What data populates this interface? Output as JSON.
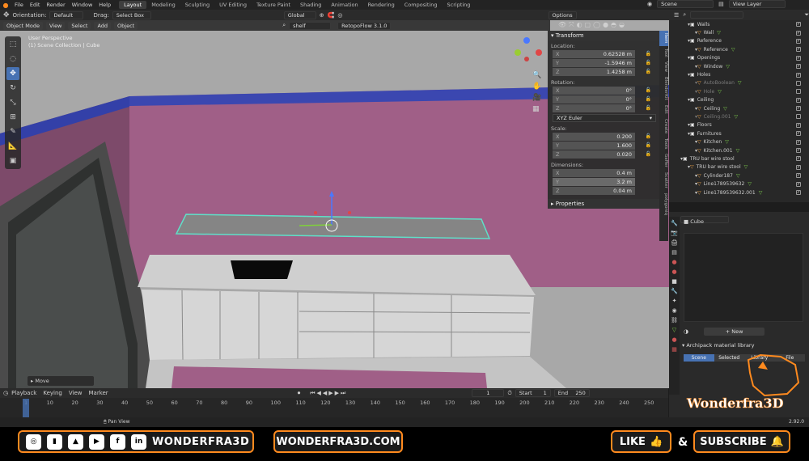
{
  "topmenu": [
    "File",
    "Edit",
    "Render",
    "Window",
    "Help"
  ],
  "workspaces": [
    "Layout",
    "Modeling",
    "Sculpting",
    "UV Editing",
    "Texture Paint",
    "Shading",
    "Animation",
    "Rendering",
    "Compositing",
    "Scripting"
  ],
  "scene_name": "Scene",
  "view_layer": "View Layer",
  "tool_header": {
    "orientation_label": "Orientation:",
    "orientation_value": "Default",
    "drag_label": "Drag:",
    "drag_value": "Select Box",
    "transform_orientation": "Global",
    "options": "Options"
  },
  "viewport_header": {
    "mode": "Object Mode",
    "menus": [
      "View",
      "Select",
      "Add",
      "Object"
    ],
    "search": "shelf",
    "addon": "RetopoFlow 3.1.0"
  },
  "viewport_info": {
    "line1": "User Perspective",
    "line2": "(1) Scene Collection | Cube"
  },
  "last_op": "Move",
  "npanel": {
    "title": "Transform",
    "location_label": "Location:",
    "location": [
      {
        "axis": "X",
        "value": "0.62528 m"
      },
      {
        "axis": "Y",
        "value": "-1.5946 m"
      },
      {
        "axis": "Z",
        "value": "1.4258 m"
      }
    ],
    "rotation_label": "Rotation:",
    "rotation": [
      {
        "axis": "X",
        "value": "0°"
      },
      {
        "axis": "Y",
        "value": "0°"
      },
      {
        "axis": "Z",
        "value": "0°"
      }
    ],
    "rotation_mode": "XYZ Euler",
    "scale_label": "Scale:",
    "scale": [
      {
        "axis": "X",
        "value": "0.200"
      },
      {
        "axis": "Y",
        "value": "1.600"
      },
      {
        "axis": "Z",
        "value": "0.020"
      }
    ],
    "dimensions_label": "Dimensions:",
    "dimensions": [
      {
        "axis": "X",
        "value": "0.4 m"
      },
      {
        "axis": "Y",
        "value": "3.2 m"
      },
      {
        "axis": "Z",
        "value": "0.04 m"
      }
    ],
    "properties_label": "Properties"
  },
  "side_tabs": [
    "Item",
    "Tool",
    "View",
    "BlenderKit",
    "Edit",
    "Create",
    "Tools",
    "Gaffer",
    "Scatter",
    "polygoniq"
  ],
  "outliner": [
    {
      "indent": 1,
      "name": "Walls",
      "type": "collection",
      "checked": true
    },
    {
      "indent": 2,
      "name": "Wall",
      "type": "object",
      "checked": true
    },
    {
      "indent": 1,
      "name": "Reference",
      "type": "collection",
      "checked": true
    },
    {
      "indent": 2,
      "name": "Reference",
      "type": "object",
      "checked": true
    },
    {
      "indent": 1,
      "name": "Openings",
      "type": "collection",
      "checked": true
    },
    {
      "indent": 2,
      "name": "Window",
      "type": "object",
      "checked": true
    },
    {
      "indent": 1,
      "name": "Holes",
      "type": "collection",
      "checked": true
    },
    {
      "indent": 2,
      "name": "AutoBoolean",
      "type": "object",
      "checked": false,
      "dim": true
    },
    {
      "indent": 2,
      "name": "Hole",
      "type": "object",
      "checked": false,
      "dim": true
    },
    {
      "indent": 1,
      "name": "Ceiling",
      "type": "collection",
      "checked": true
    },
    {
      "indent": 2,
      "name": "Ceiling",
      "type": "object",
      "checked": true
    },
    {
      "indent": 2,
      "name": "Ceiling.001",
      "type": "object",
      "checked": false,
      "dim": true
    },
    {
      "indent": 1,
      "name": "Floors",
      "type": "collection",
      "checked": true
    },
    {
      "indent": 1,
      "name": "Furnitures",
      "type": "collection",
      "checked": true
    },
    {
      "indent": 2,
      "name": "Kitchen",
      "type": "object",
      "checked": true
    },
    {
      "indent": 2,
      "name": "Kitchen.001",
      "type": "object",
      "checked": true
    },
    {
      "indent": 0,
      "name": "TRU bar wire stool",
      "type": "collection",
      "checked": true
    },
    {
      "indent": 1,
      "name": "TRU bar wire stool",
      "type": "object",
      "checked": true
    },
    {
      "indent": 2,
      "name": "Cylinder187",
      "type": "object",
      "checked": true
    },
    {
      "indent": 2,
      "name": "Line1789539632",
      "type": "object",
      "checked": true
    },
    {
      "indent": 2,
      "name": "Line1789539632.001",
      "type": "object",
      "checked": true
    }
  ],
  "properties_panel": {
    "object": "Cube",
    "new_button": "New",
    "library_title": "Archipack material library",
    "lib_tabs": [
      "Scene",
      "Selected",
      "Library",
      "File"
    ]
  },
  "timeline": {
    "menus": [
      "Playback",
      "Keying",
      "View",
      "Marker"
    ],
    "current": "1",
    "start_label": "Start",
    "start": "1",
    "end_label": "End",
    "end": "250",
    "ticks": [
      "1",
      "10",
      "20",
      "30",
      "40",
      "50",
      "60",
      "70",
      "80",
      "90",
      "100",
      "110",
      "120",
      "130",
      "140",
      "150",
      "160",
      "170",
      "180",
      "190",
      "200",
      "210",
      "220",
      "230",
      "240",
      "250"
    ]
  },
  "status": {
    "left": "Pan View",
    "version": "2.92.0"
  },
  "footer": {
    "socials": [
      "instagram",
      "twitch",
      "artstation",
      "youtube",
      "facebook",
      "linkedin"
    ],
    "brand": "WONDERFRA3D",
    "website": "WONDERFRA3D.COM",
    "like": "LIKE",
    "amp": "&",
    "subscribe": "SUBSCRIBE",
    "logo_text": "Wonderfra3D"
  },
  "colors": {
    "accent": "#4772b3",
    "orange": "#ff8a1e",
    "wall_pink": "#9e5c84",
    "wall_blue": "#3b47b0"
  }
}
